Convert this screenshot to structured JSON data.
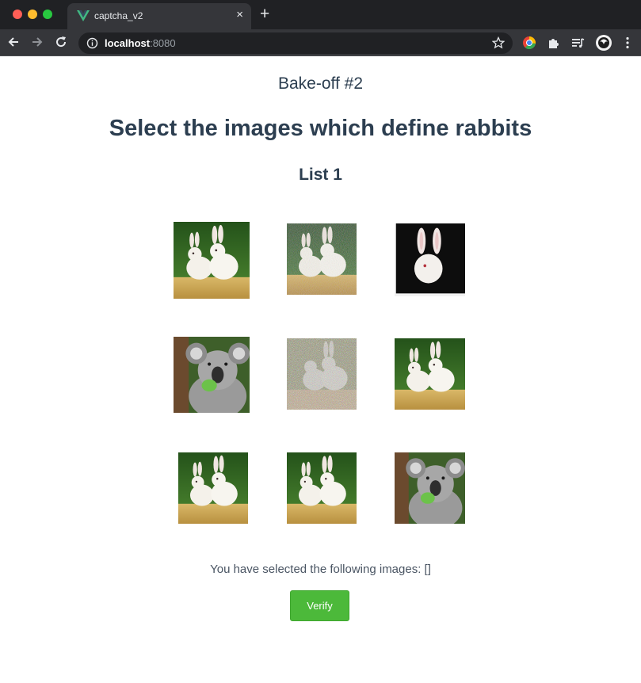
{
  "browser": {
    "tab_title": "captcha_v2",
    "tab_close": "×",
    "new_tab": "+",
    "url_host": "localhost",
    "url_port": ":8080"
  },
  "page": {
    "subtitle": "Bake-off #2",
    "headline": "Select the images which define rabbits",
    "list_name": "List 1",
    "selected_text": "You have selected the following images: []",
    "verify_label": "Verify"
  },
  "images": [
    {
      "subject": "rabbits",
      "variant": "original"
    },
    {
      "subject": "rabbits",
      "variant": "noisy"
    },
    {
      "subject": "rabbit",
      "variant": "dark-background"
    },
    {
      "subject": "koala",
      "variant": "original"
    },
    {
      "subject": "rabbits",
      "variant": "heavy-noise"
    },
    {
      "subject": "rabbits",
      "variant": "original"
    },
    {
      "subject": "rabbits",
      "variant": "original"
    },
    {
      "subject": "rabbits",
      "variant": "original"
    },
    {
      "subject": "koala",
      "variant": "original"
    }
  ],
  "colors": {
    "text": "#2c3e50",
    "button": "#4cb93a",
    "chrome_dark": "#202124",
    "chrome_tab": "#35363a"
  }
}
